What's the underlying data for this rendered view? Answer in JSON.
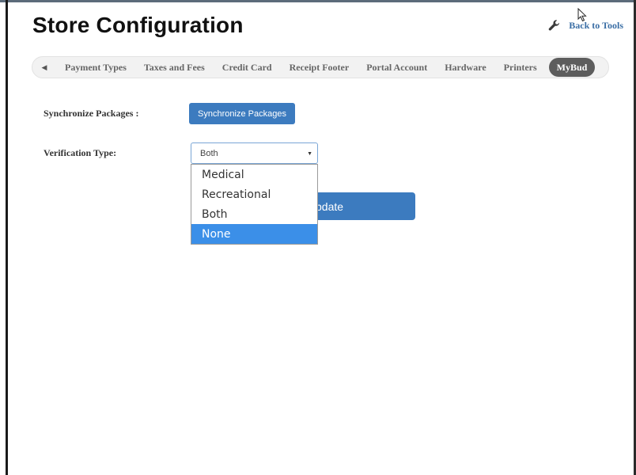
{
  "page": {
    "title": "Store Configuration",
    "back_link": "Back to Tools"
  },
  "tabs": {
    "scroll_left": "◀",
    "items": [
      {
        "label": "Payment Types"
      },
      {
        "label": "Taxes and Fees"
      },
      {
        "label": "Credit Card"
      },
      {
        "label": "Receipt Footer"
      },
      {
        "label": "Portal Account"
      },
      {
        "label": "Hardware"
      },
      {
        "label": "Printers"
      },
      {
        "label": "MyBud",
        "active": true
      }
    ]
  },
  "form": {
    "sync_label": "Synchronize Packages :",
    "sync_button": "Synchronize Packages",
    "verification_label": "Verification Type:",
    "verification_value": "Both",
    "verification_options": [
      "Medical",
      "Recreational",
      "Both",
      "None"
    ],
    "highlighted_option": "None",
    "update_button": "pdate"
  },
  "icons": {
    "back": "wrench-icon",
    "tab_scroll": "caret-left-icon",
    "select_caret": "caret-down-icon",
    "cursor": "mouse-pointer-icon"
  },
  "colors": {
    "primary_button": "#3c7bbf",
    "active_tab": "#5d5d5d",
    "link": "#3a6ea5",
    "dropdown_highlight": "#3b8fe8"
  }
}
